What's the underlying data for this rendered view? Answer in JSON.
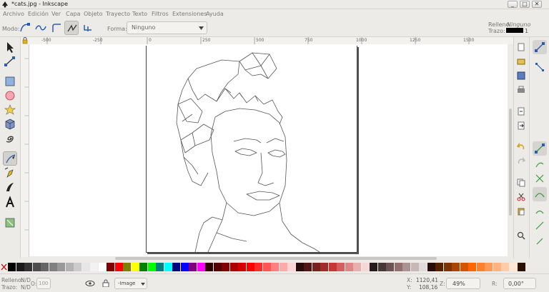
{
  "window": {
    "title": "*cats.jpg - Inkscape",
    "buttons": [
      "_",
      "□",
      "✕"
    ]
  },
  "menu": [
    "Archivo",
    "Edición",
    "Ver",
    "Capa",
    "Objeto",
    "Trayecto",
    "Texto",
    "Filtros",
    "Extensiones",
    "Ayuda"
  ],
  "controls": {
    "mode_label": "Modo:",
    "shape_label": "Forma:",
    "shape_value": "Ninguno",
    "fill_label": "Relleno:",
    "fill_value": "Ninguno",
    "stroke_label": "Trazo:",
    "stroke_width": "1"
  },
  "ruler": {
    "ticks": [
      "-500",
      "-250",
      "0",
      "250",
      "500",
      "750",
      "1000",
      "1250",
      "1500"
    ]
  },
  "toolbox": [
    "selector-tool",
    "node-tool",
    "rectangle-tool",
    "ellipse-tool",
    "star-tool",
    "3d-box-tool",
    "spiral-tool",
    "pencil-tool",
    "pen-tool",
    "calligraphy-tool",
    "text-tool",
    "gradient-tool"
  ],
  "palette": {
    "colors": [
      "#000000",
      "#1a1a1a",
      "#333333",
      "#4d4d4d",
      "#666666",
      "#808080",
      "#999999",
      "#b3b3b3",
      "#cccccc",
      "#e6e6e6",
      "#f2f2f2",
      "#ffffff",
      "#800000",
      "#ff0000",
      "#808000",
      "#ffff00",
      "#008000",
      "#00ff00",
      "#008080",
      "#00ffff",
      "#000080",
      "#0000ff",
      "#800080",
      "#ff00ff",
      "#2b0000",
      "#550000",
      "#800000",
      "#aa0000",
      "#d40000",
      "#ff0000",
      "#ff2a2a",
      "#ff5555",
      "#ff8080",
      "#ffaaaa",
      "#ffd5d5",
      "#280b0b",
      "#501616",
      "#782121",
      "#a02c2c",
      "#c83737",
      "#d35f5f",
      "#de8787",
      "#e9afaf",
      "#f4d7d7",
      "#241c1c",
      "#483737",
      "#6c5353",
      "#916f6f",
      "#ac9393",
      "#c8b7b7",
      "#e3dbdb",
      "#280b0b",
      "#552200",
      "#803300",
      "#aa4400",
      "#d45500",
      "#ff6600",
      "#ff7f2a",
      "#ff9955",
      "#ffb380",
      "#ffccaa",
      "#ffe6d5",
      "#2b1100"
    ]
  },
  "status": {
    "fill_label": "Relleno:",
    "fill_value": "N/D",
    "stroke_label": "Trazo:",
    "stroke_value": "N/D",
    "opacity_label": "O:",
    "opacity_value": "100",
    "layer": "-Image",
    "x_label": "X:",
    "x_value": "1120,41",
    "y_label": "Y:",
    "y_value": "108,16",
    "zoom_label": "Z:",
    "zoom_value": "49%",
    "rotation_label": "R:",
    "rotation_value": "0,00°"
  }
}
